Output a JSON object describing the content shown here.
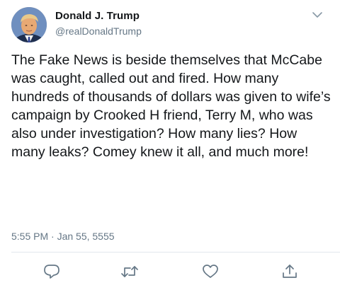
{
  "tweet": {
    "display_name": "Donald J. Trump",
    "handle": "@realDonaldTrump",
    "text": "The Fake News is beside themselves that McCabe was caught, called out and fired. How many hundreds of thousands of dollars was given to wife’s campaign by Crooked H friend, Terry M, who was also under investigation? How many lies? How many leaks? Comey knew it all, and much more!",
    "timestamp": "5:55 PM · Jan 55, 5555"
  },
  "icons": {
    "menu": "chevron-down-icon",
    "reply": "speech-bubble-icon",
    "retweet": "retweet-icon",
    "like": "heart-icon",
    "share": "share-upload-icon"
  },
  "colors": {
    "text": "#14171a",
    "secondary": "#657786",
    "divider": "#e1e8ed",
    "icon": "#657786"
  }
}
